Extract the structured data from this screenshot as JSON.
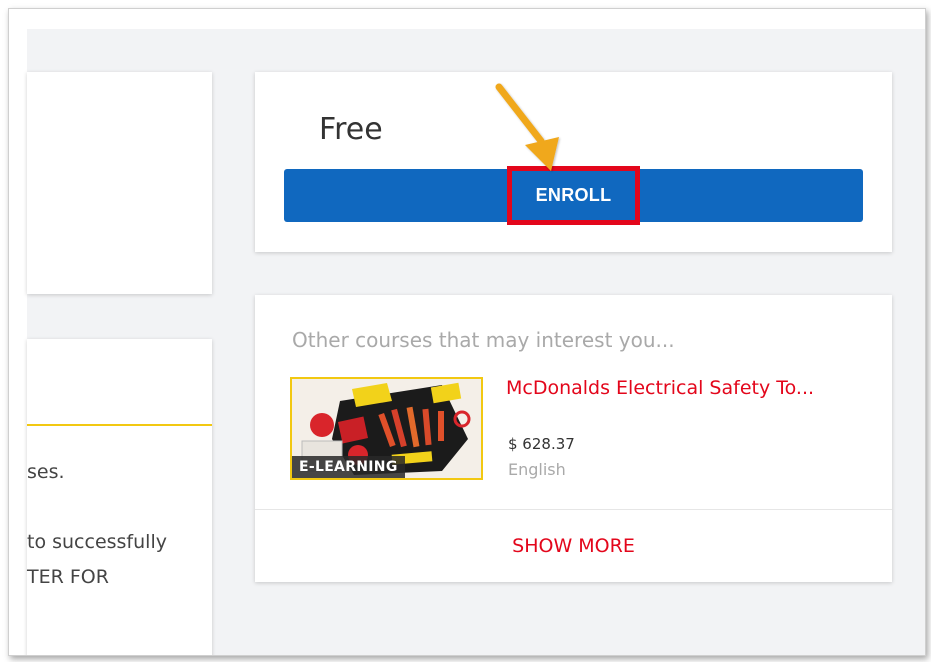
{
  "left_panel": {
    "snippets": [
      "ses.",
      "to successfully",
      "TER FOR"
    ]
  },
  "pricing": {
    "price": "Free",
    "enroll_label": "ENROLL"
  },
  "other_courses": {
    "heading": "Other courses that may interest you...",
    "items": [
      {
        "title": "McDonalds Electrical Safety To...",
        "price": "$ 628.37",
        "language": "English",
        "badge": "E-LEARNING",
        "thumbnail_icon": "electrical-safety-tools-image"
      }
    ],
    "show_more_label": "SHOW MORE"
  },
  "colors": {
    "enroll_button": "#1068bf",
    "highlight_box": "#e3061b",
    "annotation_arrow": "#f0a81c",
    "accent_line": "#f2c811",
    "link_red": "#e3061b"
  }
}
